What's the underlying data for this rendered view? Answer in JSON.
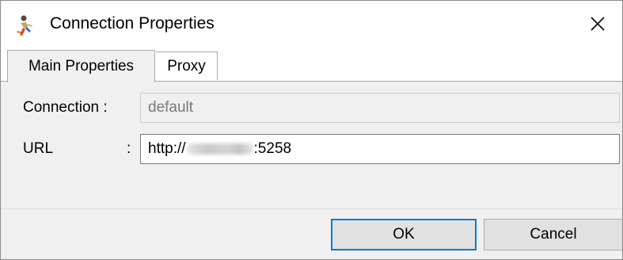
{
  "window": {
    "title": "Connection Properties",
    "icon": "person-run-icon",
    "close_icon": "close-icon"
  },
  "tabs": [
    {
      "label": "Main Properties",
      "selected": true
    },
    {
      "label": "Proxy",
      "selected": false
    }
  ],
  "form": {
    "connection_label": "Connection :",
    "connection_value": "default",
    "url_label": "URL",
    "url_colon": ":",
    "url_prefix": "http://",
    "url_suffix": ":5258"
  },
  "buttons": {
    "ok": "OK",
    "cancel": "Cancel"
  },
  "colors": {
    "focus_border": "#0078d7",
    "background": "#f0f0f0"
  }
}
